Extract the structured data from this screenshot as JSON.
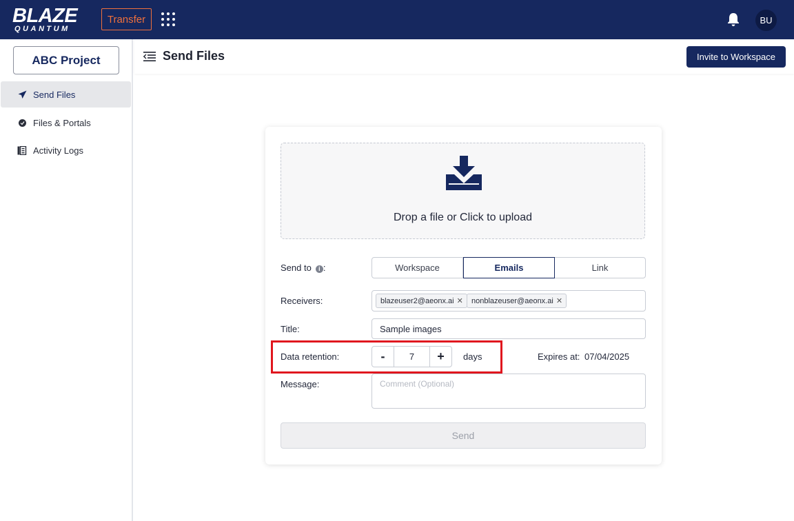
{
  "topbar": {
    "logo_main": "BLAZE",
    "logo_sub": "QUANTUM",
    "transfer_label": "Transfer",
    "avatar_initials": "BU",
    "bg_color": "#16285f",
    "accent_color": "#f0703c"
  },
  "sidebar": {
    "project_label": "ABC Project",
    "items": [
      {
        "label": "Send Files",
        "icon": "send-icon",
        "active": true
      },
      {
        "label": "Files & Portals",
        "icon": "files-icon",
        "active": false
      },
      {
        "label": "Activity Logs",
        "icon": "logs-icon",
        "active": false
      }
    ]
  },
  "header": {
    "title": "Send Files",
    "invite_label": "Invite to Workspace"
  },
  "form": {
    "drop_text": "Drop a file or Click to upload",
    "send_to_label": "Send to",
    "send_to_suffix": ":",
    "send_to_options": [
      "Workspace",
      "Emails",
      "Link"
    ],
    "send_to_selected": "Emails",
    "receivers_label": "Receivers:",
    "receivers": [
      "blazeuser2@aeonx.ai",
      "nonblazeuser@aeonx.ai"
    ],
    "title_label": "Title:",
    "title_value": "Sample images",
    "retention_label": "Data retention:",
    "retention_value": "7",
    "retention_unit": "days",
    "minus": "-",
    "plus": "+",
    "expires_label": "Expires at:",
    "expires_value": "07/04/2025",
    "message_label": "Message:",
    "message_placeholder": "Comment (Optional)",
    "send_label": "Send"
  }
}
